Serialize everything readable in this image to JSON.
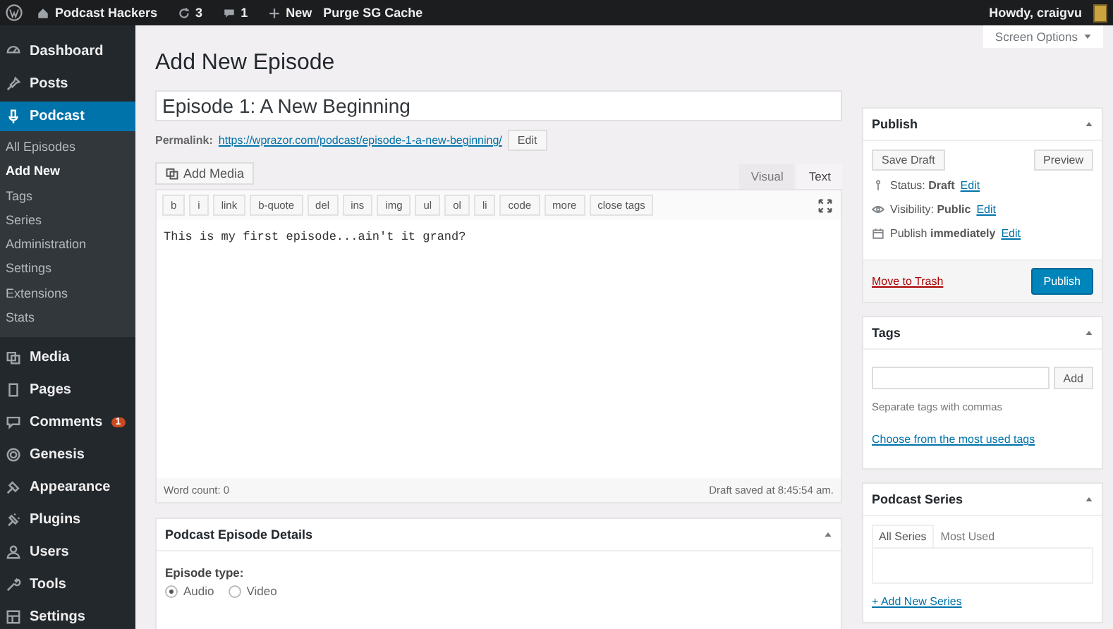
{
  "admin_bar": {
    "site_name": "Podcast Hackers",
    "updates_count": "3",
    "comments_count": "1",
    "new_label": "New",
    "purge_label": "Purge SG Cache",
    "greeting": "Howdy, craigvu"
  },
  "sidebar": {
    "items": [
      {
        "label": "Dashboard",
        "selected": false
      },
      {
        "label": "Posts",
        "selected": false
      },
      {
        "label": "Podcast",
        "selected": true,
        "children": [
          {
            "label": "All Episodes",
            "selected": false
          },
          {
            "label": "Add New",
            "selected": true
          },
          {
            "label": "Tags",
            "selected": false
          },
          {
            "label": "Series",
            "selected": false
          },
          {
            "label": "Administration",
            "selected": false
          },
          {
            "label": "Settings",
            "selected": false
          },
          {
            "label": "Extensions",
            "selected": false
          },
          {
            "label": "Stats",
            "selected": false
          }
        ]
      },
      {
        "label": "Media",
        "selected": false
      },
      {
        "label": "Pages",
        "selected": false
      },
      {
        "label": "Comments",
        "selected": false,
        "badge": "1"
      },
      {
        "label": "Genesis",
        "selected": false
      },
      {
        "label": "Appearance",
        "selected": false
      },
      {
        "label": "Plugins",
        "selected": false
      },
      {
        "label": "Users",
        "selected": false
      },
      {
        "label": "Tools",
        "selected": false
      },
      {
        "label": "Settings",
        "selected": false
      }
    ]
  },
  "screen_options": "Screen Options",
  "page_title": "Add New Episode",
  "editor": {
    "title": "Episode 1: A New Beginning",
    "permalink_label": "Permalink:",
    "permalink_url": "https://wprazor.com/podcast/episode-1-a-new-beginning/",
    "permalink_edit": "Edit",
    "add_media": "Add Media",
    "tabs": [
      {
        "label": "Visual",
        "selected": false
      },
      {
        "label": "Text",
        "selected": true
      }
    ],
    "toolbar": [
      "b",
      "i",
      "link",
      "b-quote",
      "del",
      "ins",
      "img",
      "ul",
      "ol",
      "li",
      "code",
      "more",
      "close tags"
    ],
    "content": "This is my first episode...ain't it grand?",
    "word_count": "Word count: 0",
    "draft_saved": "Draft saved at 8:45:54 am."
  },
  "details": {
    "title": "Podcast Episode Details",
    "field_label": "Episode type:",
    "options": [
      {
        "label": "Audio",
        "selected": true
      },
      {
        "label": "Video",
        "selected": false
      }
    ]
  },
  "publish": {
    "title": "Publish",
    "save_draft": "Save Draft",
    "preview": "Preview",
    "rows": [
      {
        "label": "Status:",
        "value": "Draft",
        "link": "Edit"
      },
      {
        "label": "Visibility:",
        "value": "Public",
        "link": "Edit"
      },
      {
        "label": "Publish",
        "value": "immediately",
        "link": "Edit"
      }
    ],
    "trash": "Move to Trash",
    "button": "Publish"
  },
  "tags": {
    "title": "Tags",
    "add": "Add",
    "hint": "Separate tags with commas",
    "link": "Choose from the most used tags"
  },
  "series": {
    "title": "Podcast Series",
    "tabs": [
      {
        "label": "All Series",
        "selected": true
      },
      {
        "label": "Most Used",
        "selected": false
      }
    ],
    "add_link": "+ Add New Series"
  }
}
